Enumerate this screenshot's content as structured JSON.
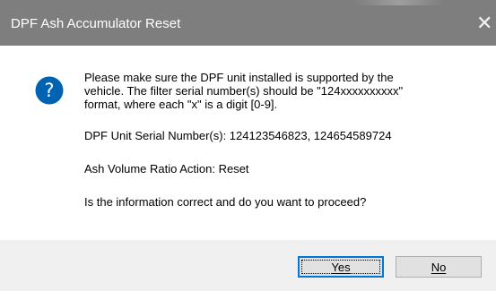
{
  "window": {
    "title": "DPF Ash Accumulator Reset"
  },
  "icons": {
    "question": "question-icon",
    "close": "close-icon"
  },
  "message": {
    "line1": "Please make sure the DPF unit installed is supported by the",
    "line2": "vehicle. The filter serial number(s) should be \"124xxxxxxxxxx\"",
    "line3": "format, where each \"x\" is a digit [0-9].",
    "serials": "DPF Unit Serial Number(s): 124123546823, 124654589724",
    "action": "Ash Volume Ratio Action: Reset",
    "question": "Is the information correct and do you want to proceed?"
  },
  "buttons": {
    "yes_label": "Yes",
    "no_label": "No"
  },
  "colors": {
    "titlebar": "#7e7e7e",
    "icon_blue": "#0063b1",
    "default_button_border": "#0078d7",
    "footer": "#f0f0f0"
  }
}
